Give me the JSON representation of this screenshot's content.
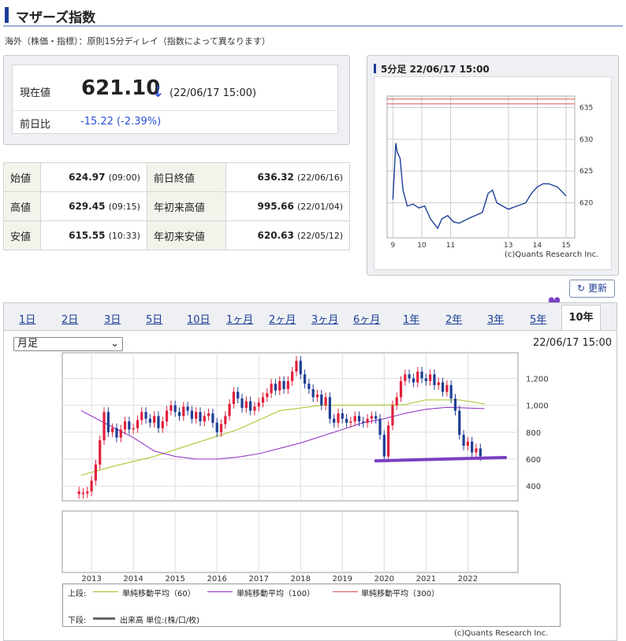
{
  "page": {
    "title": "マザーズ指数",
    "note": "海外（株価・指標）：原則15分ディレイ（指数によって異なります）"
  },
  "quote": {
    "current_label": "現在値",
    "price": "621.10",
    "arrow": "↓",
    "time": "(22/06/17 15:00)",
    "change_label": "前日比",
    "change": "-15.22 (-2.39%)"
  },
  "stats": [
    {
      "label": "始値",
      "value": "624.97",
      "time": "(09:00)",
      "label2": "前日終値",
      "value2": "636.32",
      "time2": "(22/06/16)"
    },
    {
      "label": "高値",
      "value": "629.45",
      "time": "(09:15)",
      "label2": "年初来高値",
      "value2": "995.66",
      "time2": "(22/01/04)"
    },
    {
      "label": "安値",
      "value": "615.55",
      "time": "(10:33)",
      "label2": "年初来安値",
      "value2": "620.63",
      "time2": "(22/05/12)"
    }
  ],
  "mini_chart": {
    "header": "5分足 22/06/17 15:00",
    "copyright": "(c)Quants Research Inc."
  },
  "refresh_label": "更新",
  "tabs": [
    "1日",
    "2日",
    "3日",
    "5日",
    "10日",
    "1ヶ月",
    "2ヶ月",
    "3ヶ月",
    "6ヶ月",
    "1年",
    "2年",
    "3年",
    "5年",
    "10年"
  ],
  "selected_tab": "10年",
  "period_select": "月足",
  "main_timestamp": "22/06/17 15:00",
  "legend": {
    "upper": "上段:",
    "ma60": "単純移動平均（60）",
    "ma100": "単純移動平均（100）",
    "ma300": "単純移動平均（300）",
    "lower": "下段:",
    "volume": "出来高 単位:(株/口/枚)"
  },
  "main_copyright": "(c)Quants Research Inc.",
  "colors": {
    "accent": "#1d3e96",
    "up": "#e0203c",
    "down": "#1d3e96",
    "ma60": "#a6c020",
    "ma100": "#8a2cc0",
    "ma300": "#e05050",
    "annotation": "#7c3fc2"
  },
  "chart_data": [
    {
      "type": "line",
      "title": "5分足 22/06/17 15:00",
      "x": [
        9,
        9.05,
        9.1,
        9.15,
        9.25,
        9.35,
        9.5,
        9.7,
        9.9,
        10.1,
        10.3,
        10.55,
        10.7,
        10.9,
        11.1,
        11.3,
        11.6,
        12.1,
        12.3,
        12.45,
        12.6,
        12.8,
        13.0,
        13.3,
        13.6,
        13.8,
        14.0,
        14.2,
        14.4,
        14.7,
        15.0
      ],
      "series": [
        {
          "values": [
            620.5,
            624.9,
            629.4,
            628.0,
            627.0,
            622.0,
            619.5,
            619.8,
            619.2,
            619.5,
            617.5,
            616.0,
            617.5,
            618.0,
            617.0,
            616.8,
            617.5,
            618.5,
            621.5,
            622.0,
            620.0,
            619.5,
            619.0,
            619.5,
            620.0,
            621.5,
            622.5,
            623.0,
            623.0,
            622.5,
            621.1
          ]
        }
      ],
      "x_ticks": [
        "9",
        "10",
        "11",
        "13",
        "14",
        "15"
      ],
      "y_ticks": [
        "635",
        "630",
        "625",
        "620"
      ],
      "ylim": [
        614.5,
        636.8
      ],
      "reference_line": 636.32
    },
    {
      "type": "bar",
      "title": "",
      "x_ticks": [
        "2013",
        "2014",
        "2015",
        "2016",
        "2017",
        "2018",
        "2019",
        "2020",
        "2021",
        "2022"
      ],
      "y_ticks": [
        "1,200",
        "1,000",
        "800",
        "600",
        "400"
      ],
      "ylim": [
        290,
        1390
      ],
      "series": [
        {
          "name": "単純移動平均（60）",
          "values": [
            [
              2012.75,
              480
            ],
            [
              2013.5,
              545
            ],
            [
              2014.5,
              620
            ],
            [
              2015.5,
              720
            ],
            [
              2016.5,
              820
            ],
            [
              2017.5,
              960
            ],
            [
              2018.5,
              1000
            ],
            [
              2019.5,
              1000
            ],
            [
              2020.5,
              1005
            ],
            [
              2021.0,
              1040
            ],
            [
              2021.8,
              1040
            ],
            [
              2022.4,
              1010
            ]
          ]
        },
        {
          "name": "単純移動平均（100）",
          "values": [
            [
              2012.75,
              960
            ],
            [
              2013.3,
              870
            ],
            [
              2014.0,
              760
            ],
            [
              2014.5,
              660
            ],
            [
              2015.0,
              620
            ],
            [
              2015.5,
              600
            ],
            [
              2016.0,
              600
            ],
            [
              2016.5,
              615
            ],
            [
              2017.0,
              640
            ],
            [
              2017.5,
              680
            ],
            [
              2018.0,
              720
            ],
            [
              2018.5,
              770
            ],
            [
              2019.0,
              820
            ],
            [
              2019.5,
              870
            ],
            [
              2020.0,
              900
            ],
            [
              2020.5,
              940
            ],
            [
              2021.0,
              970
            ],
            [
              2021.5,
              985
            ],
            [
              2022.4,
              975
            ]
          ]
        }
      ],
      "candles": [
        [
          2012.7,
          340,
          360
        ],
        [
          2012.8,
          340,
          350
        ],
        [
          2012.9,
          345,
          360
        ],
        [
          2013.0,
          360,
          440
        ],
        [
          2013.1,
          440,
          560
        ],
        [
          2013.2,
          560,
          740
        ],
        [
          2013.3,
          740,
          950
        ],
        [
          2013.4,
          950,
          800
        ],
        [
          2013.5,
          800,
          830
        ],
        [
          2013.6,
          830,
          760
        ],
        [
          2013.7,
          760,
          820
        ],
        [
          2013.8,
          820,
          880
        ],
        [
          2013.9,
          880,
          820
        ],
        [
          2014.0,
          820,
          830
        ],
        [
          2014.1,
          830,
          890
        ],
        [
          2014.2,
          890,
          950
        ],
        [
          2014.3,
          950,
          900
        ],
        [
          2014.4,
          900,
          870
        ],
        [
          2014.5,
          870,
          920
        ],
        [
          2014.6,
          920,
          830
        ],
        [
          2014.7,
          830,
          880
        ],
        [
          2014.8,
          880,
          960
        ],
        [
          2014.9,
          960,
          1000
        ],
        [
          2015.0,
          1000,
          950
        ],
        [
          2015.1,
          950,
          920
        ],
        [
          2015.2,
          920,
          990
        ],
        [
          2015.3,
          990,
          960
        ],
        [
          2015.4,
          960,
          900
        ],
        [
          2015.5,
          900,
          950
        ],
        [
          2015.6,
          950,
          880
        ],
        [
          2015.7,
          880,
          920
        ],
        [
          2015.8,
          920,
          940
        ],
        [
          2015.9,
          940,
          870
        ],
        [
          2016.0,
          870,
          800
        ],
        [
          2016.1,
          800,
          860
        ],
        [
          2016.2,
          860,
          920
        ],
        [
          2016.3,
          920,
          1010
        ],
        [
          2016.4,
          1010,
          1100
        ],
        [
          2016.5,
          1100,
          1050
        ],
        [
          2016.6,
          1050,
          980
        ],
        [
          2016.7,
          980,
          1030
        ],
        [
          2016.8,
          1030,
          960
        ],
        [
          2016.9,
          960,
          990
        ],
        [
          2017.0,
          990,
          1020
        ],
        [
          2017.1,
          1020,
          1060
        ],
        [
          2017.2,
          1060,
          1090
        ],
        [
          2017.3,
          1090,
          1160
        ],
        [
          2017.4,
          1160,
          1110
        ],
        [
          2017.5,
          1110,
          1180
        ],
        [
          2017.6,
          1180,
          1120
        ],
        [
          2017.7,
          1120,
          1180
        ],
        [
          2017.8,
          1180,
          1250
        ],
        [
          2017.9,
          1250,
          1330
        ],
        [
          2018.0,
          1330,
          1230
        ],
        [
          2018.1,
          1230,
          1160
        ],
        [
          2018.2,
          1160,
          1120
        ],
        [
          2018.3,
          1120,
          1060
        ],
        [
          2018.4,
          1060,
          1080
        ],
        [
          2018.5,
          1080,
          1000
        ],
        [
          2018.6,
          1000,
          1060
        ],
        [
          2018.7,
          1060,
          900
        ],
        [
          2018.8,
          900,
          870
        ],
        [
          2018.9,
          870,
          940
        ],
        [
          2019.0,
          940,
          900
        ],
        [
          2019.1,
          900,
          870
        ],
        [
          2019.2,
          870,
          880
        ],
        [
          2019.3,
          880,
          920
        ],
        [
          2019.4,
          920,
          880
        ],
        [
          2019.5,
          880,
          870
        ],
        [
          2019.6,
          870,
          900
        ],
        [
          2019.7,
          900,
          920
        ],
        [
          2019.8,
          920,
          900
        ],
        [
          2019.9,
          900,
          780
        ],
        [
          2020.0,
          780,
          620
        ],
        [
          2020.1,
          620,
          850
        ],
        [
          2020.2,
          850,
          1000
        ],
        [
          2020.3,
          1000,
          1060
        ],
        [
          2020.4,
          1060,
          1180
        ],
        [
          2020.5,
          1180,
          1230
        ],
        [
          2020.6,
          1230,
          1200
        ],
        [
          2020.7,
          1200,
          1170
        ],
        [
          2020.8,
          1170,
          1250
        ],
        [
          2020.9,
          1250,
          1200
        ],
        [
          2021.0,
          1200,
          1180
        ],
        [
          2021.1,
          1180,
          1230
        ],
        [
          2021.2,
          1230,
          1150
        ],
        [
          2021.3,
          1150,
          1170
        ],
        [
          2021.4,
          1170,
          1100
        ],
        [
          2021.5,
          1100,
          1150
        ],
        [
          2021.6,
          1150,
          1050
        ],
        [
          2021.7,
          1050,
          960
        ],
        [
          2021.8,
          960,
          780
        ],
        [
          2021.9,
          780,
          700
        ],
        [
          2022.0,
          700,
          730
        ],
        [
          2022.1,
          730,
          650
        ],
        [
          2022.2,
          650,
          680
        ],
        [
          2022.3,
          680,
          621
        ]
      ],
      "annotation_line": [
        [
          2019.8,
          587
        ],
        [
          2022.9,
          612
        ]
      ]
    }
  ]
}
